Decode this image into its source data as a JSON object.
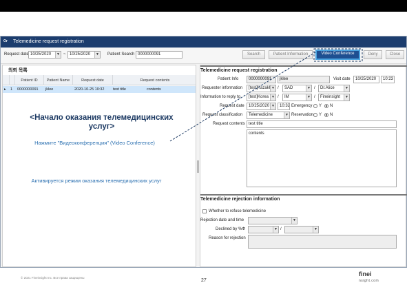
{
  "window": {
    "logo": "Or",
    "title": "Telemedicine request registration"
  },
  "toolbar": {
    "request_date_label": "Request date",
    "date_from": "10/25/2020",
    "date_sep": "~",
    "date_to": "10/25/2020",
    "patient_search_label": "Patient Search",
    "patient_search_value": "0000000091",
    "search_btn": "Search",
    "patient_info_btn": "Patient Information",
    "video_conf_btn": "Video Conference",
    "deny_btn": "Deny",
    "close_btn": "Close"
  },
  "left": {
    "section_title": "의뢰 목록",
    "columns": [
      "",
      "Patient ID",
      "Patient Name",
      "Request date",
      "Request contents"
    ],
    "row": {
      "marker": "▸",
      "num": "1",
      "patient_id": "0000000091",
      "name": "jklee",
      "date": "2020-10-25 10:32",
      "title": "test title",
      "contents": "contents"
    }
  },
  "overlay": {
    "heading": "<Начало оказания телемедицинских услуг>",
    "instruction": "Нажмите \"Видеоконференция\" (Video Conference)",
    "result": "Активируется режим оказания телемедицинских услуг"
  },
  "right": {
    "section_title": "Telemedicine request registration",
    "patient_info_label": "Patient Info",
    "patient_id": "0000000091",
    "patient_name": "jklee",
    "visit_date_label": "Visit date",
    "visit_date": "10/25/2020",
    "visit_time": "10:23",
    "requester_label": "Requester information",
    "requester_country": "[test]Kazakh:",
    "requester_dept": "SAD",
    "requester_doc": "Dr.Alice",
    "reply_label": "Information to reply to",
    "reply_country": "[test]Korea",
    "reply_dept": "IM",
    "reply_doc": "Fineinsight",
    "request_date_label": "Request date",
    "request_date": "10/25/2020",
    "request_time": "10:32",
    "emergency_label": "Emergency",
    "reservation_label": "Reservation",
    "yes": "Y",
    "no": "N",
    "slash": "/",
    "classification_label": "Request classification",
    "classification": "Telemedicine",
    "contents_label": "Request contents",
    "contents_title": "test title",
    "contents_body": "contents"
  },
  "rejection": {
    "section_title": "Telemedicine rejection information",
    "refuse_label": "Whether to refuse telemedicine",
    "date_label": "Rejection date and time",
    "declined_label": "Declined by %Φ",
    "reason_label": "Reason for rejection"
  },
  "footer": {
    "copyright": "© 2021 Fineinsight Inc. Все права защищены",
    "page": "27",
    "brand": "finei",
    "brand_sub": "nsight.com"
  },
  "colors": {
    "titlebar": "#1c3d6e",
    "accent": "#1e4f91",
    "selected_row": "#cfe6fb",
    "overlay_heading": "#1d3a63",
    "overlay_text": "#2a6fb0"
  }
}
